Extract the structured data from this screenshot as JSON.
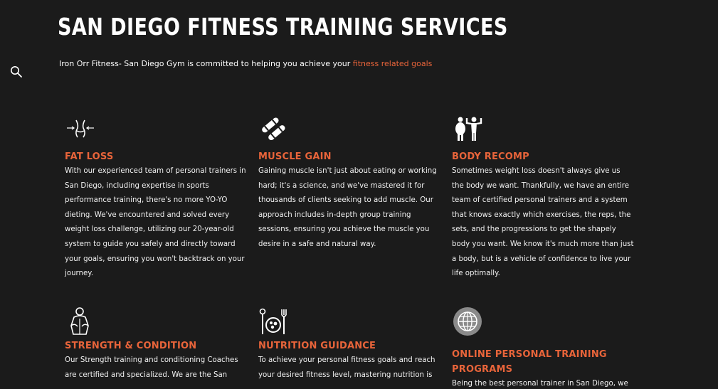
{
  "header": {
    "title": "SAN DIEGO FITNESS TRAINING SERVICES",
    "intro_text": "Iron Orr Fitness- San Diego Gym is committed to helping you achieve your ",
    "intro_link": "fitness related goals"
  },
  "services": [
    {
      "icon": "waist-measure-icon",
      "title": "FAT LOSS",
      "text": "With our experienced team of personal trainers in San Diego, including expertise in sports performance training, there's no more YO-YO dieting. We've encountered and solved every weight loss challenge, utilizing our 20-year-old system to guide you safely and directly toward your goals, ensuring you won't backtrack on your journey."
    },
    {
      "icon": "dumbbells-icon",
      "title": "MUSCLE GAIN",
      "text": "Gaining muscle isn't just about eating or working hard; it's a science, and we've mastered it for thousands of clients seeking to add muscle. Our approach includes in-depth group training sessions, ensuring you achieve the muscle you desire in a safe and natural way."
    },
    {
      "icon": "body-transformation-icon",
      "title": "BODY RECOMP",
      "text": "Sometimes weight loss doesn't always give us the body we want. Thankfully, we have an entire team of certified personal trainers and a system that knows exactly which exercises, the reps, the sets, and the progressions to get the shapely body you want.  We know it's much more than just a body, but is a vehicle of confidence to live your life optimally."
    },
    {
      "icon": "strong-person-icon",
      "title": "STRENGTH & CONDITION",
      "text": "Our Strength training and conditioning Coaches are certified and specialized.  We are the San"
    },
    {
      "icon": "nutrition-plate-icon",
      "title": "NUTRITION GUIDANCE",
      "text": "To achieve your personal fitness goals and reach your desired fitness level, mastering nutrition is"
    },
    {
      "icon": "globe-icon",
      "title": "ONLINE PERSONAL TRAINING PROGRAMS",
      "text": "Being the best personal trainer in San Diego, we"
    }
  ],
  "colors": {
    "background": "#1b1b1b",
    "accent": "#e8643a",
    "text": "#ffffff"
  }
}
